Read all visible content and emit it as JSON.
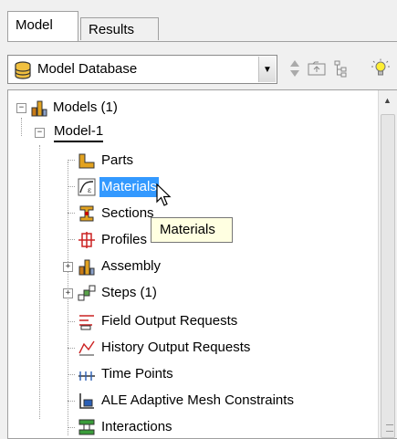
{
  "tabs": [
    {
      "label": "Model",
      "active": true
    },
    {
      "label": "Results",
      "active": false
    }
  ],
  "toolbar": {
    "database_select": {
      "value": "Model Database",
      "icon": "database-icon"
    },
    "buttons": [
      {
        "name": "expand-up-down-icon"
      },
      {
        "name": "folder-up-icon"
      },
      {
        "name": "tree-filter-icon"
      },
      {
        "name": "lightbulb-icon"
      }
    ]
  },
  "tree": {
    "models": {
      "label": "Models (1)",
      "icon": "models-icon",
      "expanded": true
    },
    "model": {
      "label": "Model-1",
      "expanded": true
    },
    "items": [
      {
        "label": "Parts",
        "icon": "parts-icon"
      },
      {
        "label": "Materials",
        "icon": "materials-icon",
        "selected": true
      },
      {
        "label": "Sections",
        "icon": "sections-icon"
      },
      {
        "label": "Profiles",
        "icon": "profiles-icon"
      },
      {
        "label": "Assembly",
        "icon": "assembly-icon",
        "expandable": true
      },
      {
        "label": "Steps (1)",
        "icon": "steps-icon",
        "expandable": true
      },
      {
        "label": "Field Output Requests",
        "icon": "field-output-icon"
      },
      {
        "label": "History Output Requests",
        "icon": "history-output-icon"
      },
      {
        "label": "Time Points",
        "icon": "time-points-icon"
      },
      {
        "label": "ALE Adaptive Mesh Constraints",
        "icon": "ale-mesh-icon"
      },
      {
        "label": "Interactions",
        "icon": "interactions-icon"
      }
    ]
  },
  "tooltip": {
    "text": "Materials"
  },
  "colors": {
    "selection": "#3399ff",
    "tooltip_bg": "#ffffe1",
    "panel_bg": "#f0f0f0"
  }
}
